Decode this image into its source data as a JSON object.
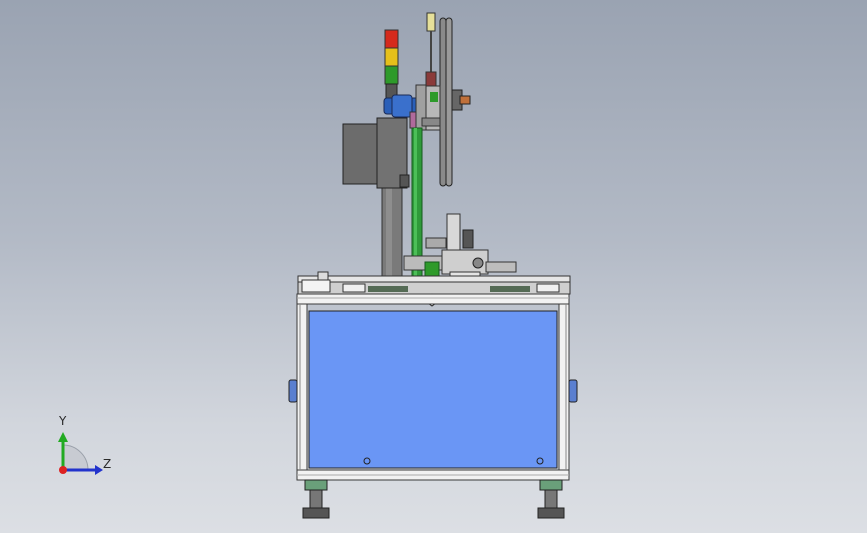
{
  "viewport": {
    "background_top": "#9aa3b2",
    "background_bottom": "#dcdfe4"
  },
  "triad": {
    "y_label": "Y",
    "z_label": "Z",
    "y_color": "#22aa22",
    "z_color": "#2233cc",
    "x_color": "#dd2222"
  },
  "colors": {
    "panel_blue": "#6a96f5",
    "frame": "#f2f2f2",
    "frame_edge": "#3a3a3a",
    "green_rod": "#2f9a3a",
    "motor_blue": "#2a5fb8",
    "gray_box": "#6e6e6e",
    "light_red": "#d52a1c",
    "light_yellow": "#e6c01a",
    "light_green": "#2e9a2a",
    "handle_blue": "#5a7fd0"
  }
}
